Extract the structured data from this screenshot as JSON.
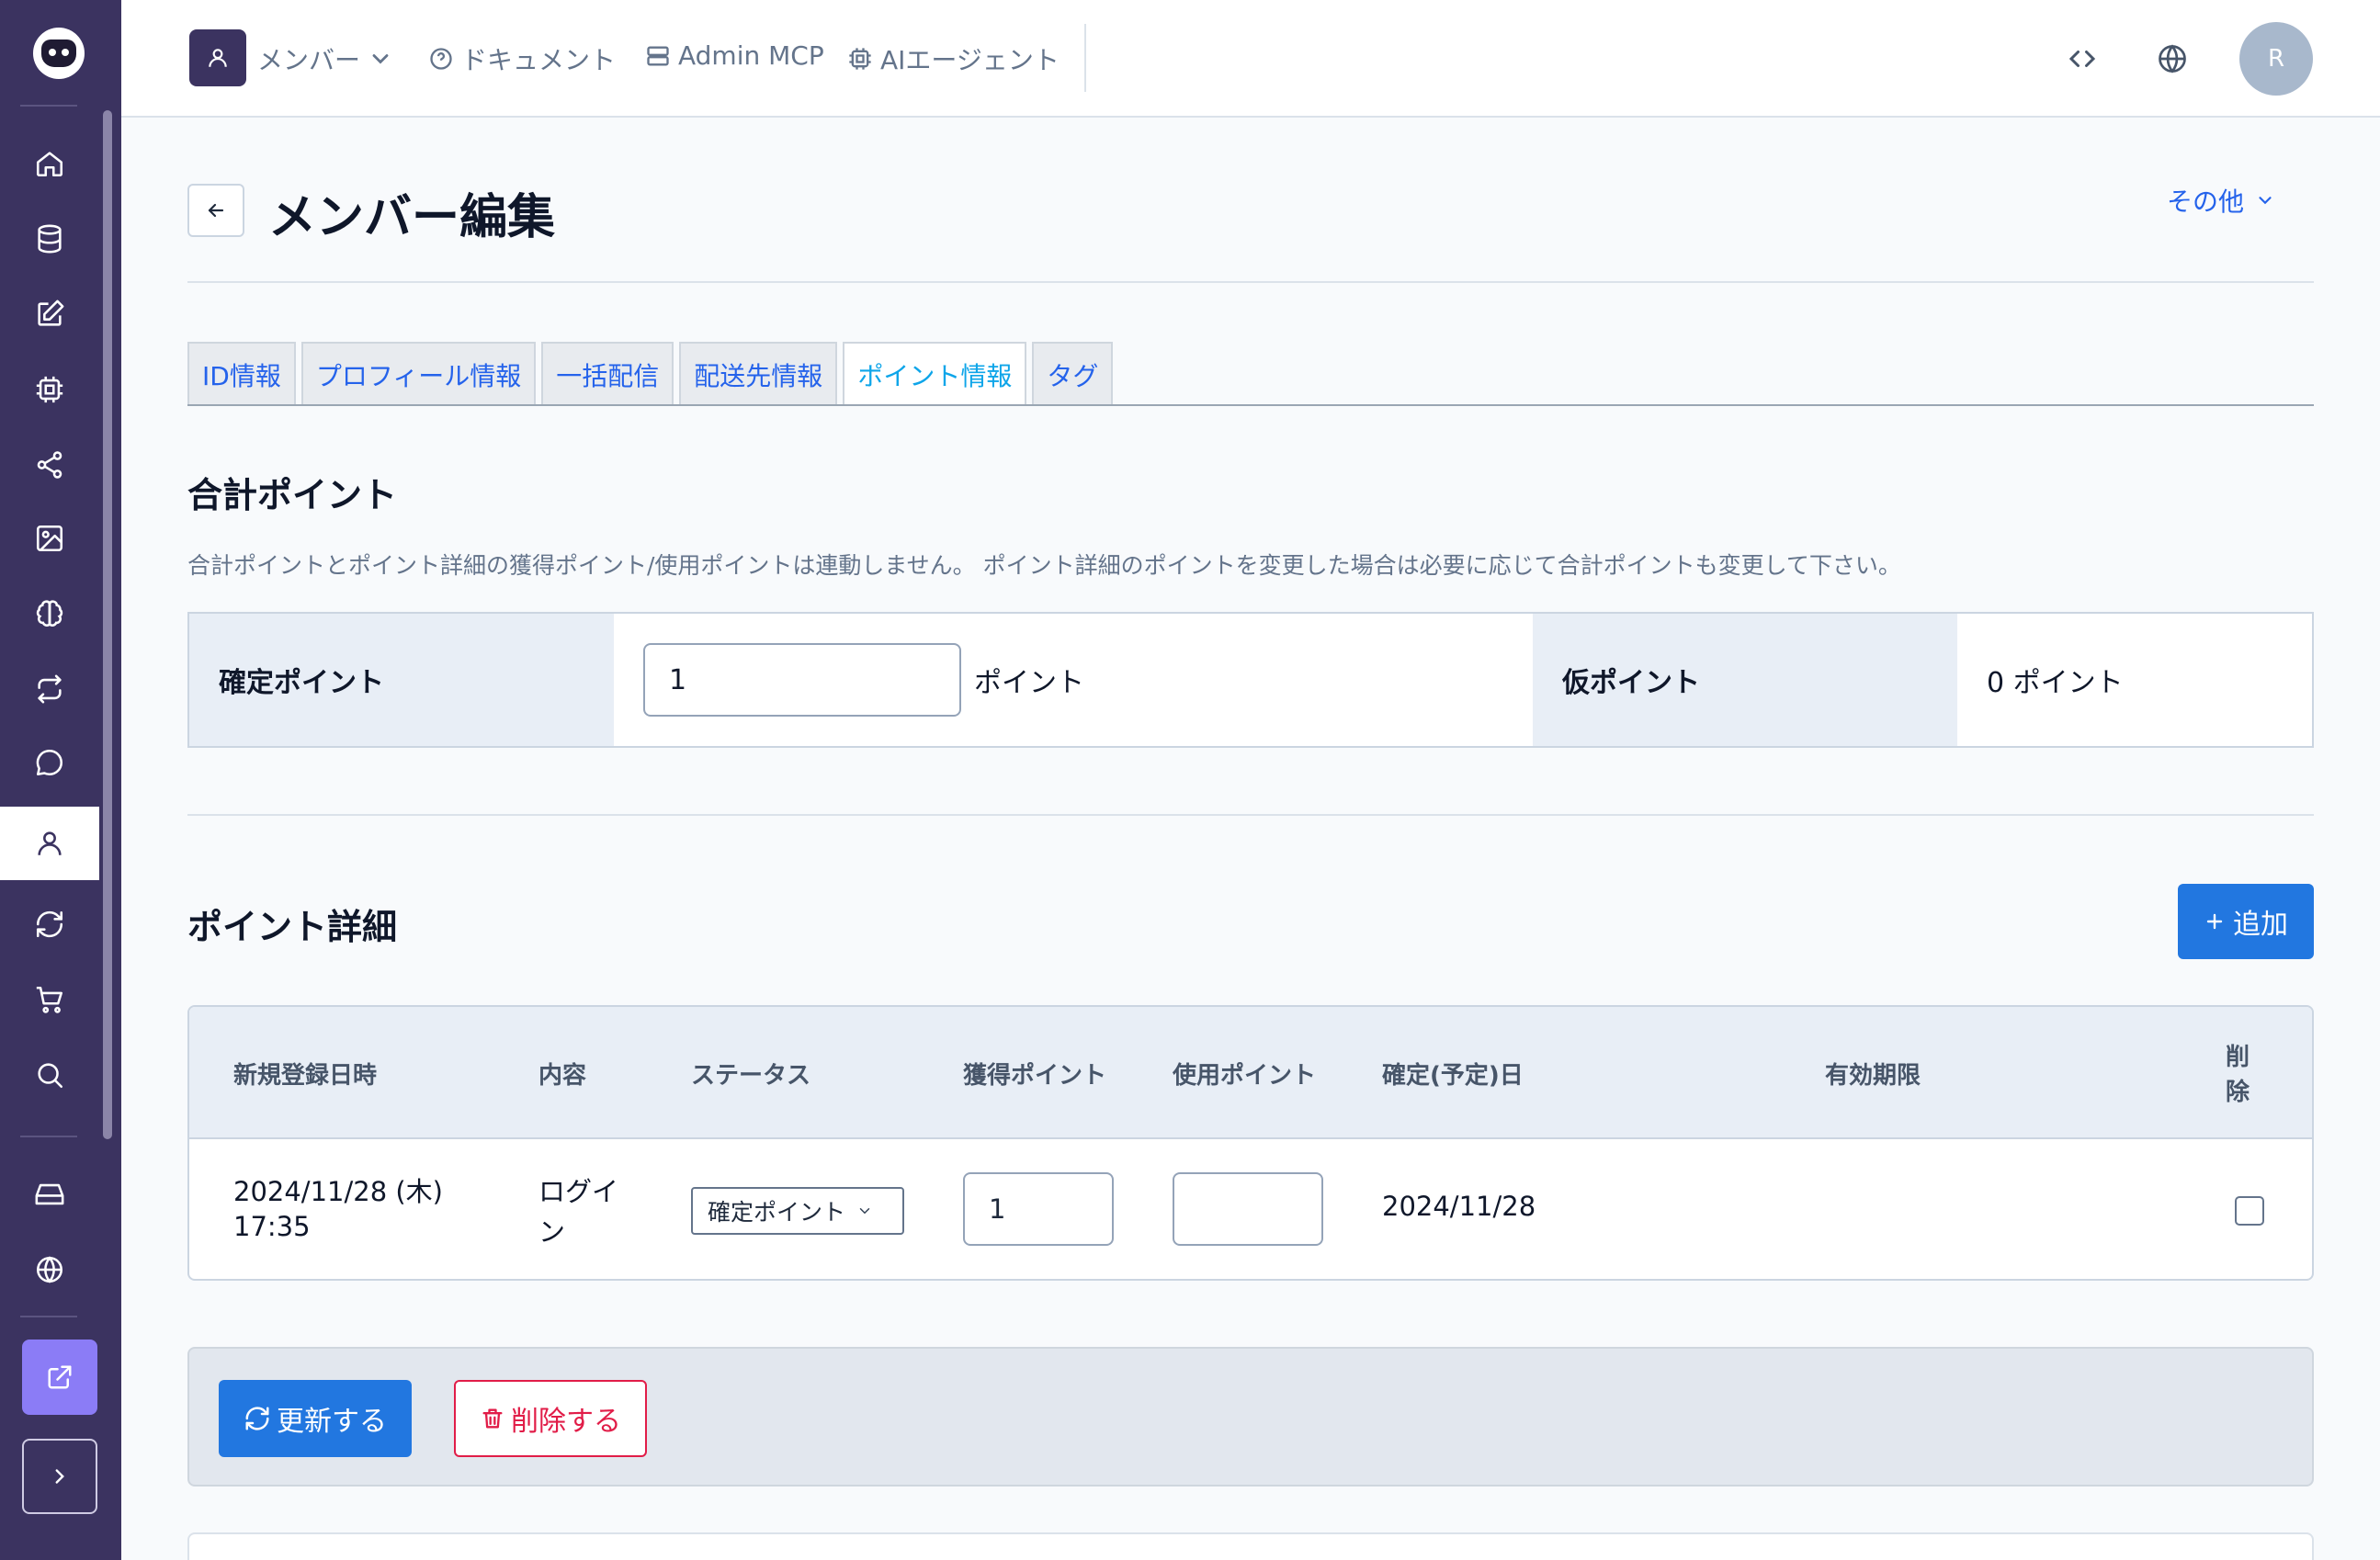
{
  "topbar": {
    "member_menu": "メンバー",
    "docs_link": "ドキュメント",
    "admin_mcp_link": "Admin MCP",
    "ai_agent_link": "AIエージェント",
    "avatar_initial": "R"
  },
  "page": {
    "title": "メンバー編集",
    "other_menu": "その他"
  },
  "tabs": [
    {
      "label": "ID情報",
      "active": false
    },
    {
      "label": "プロフィール情報",
      "active": false
    },
    {
      "label": "一括配信",
      "active": false
    },
    {
      "label": "配送先情報",
      "active": false
    },
    {
      "label": "ポイント情報",
      "active": true
    },
    {
      "label": "タグ",
      "active": false
    }
  ],
  "total_points": {
    "title": "合計ポイント",
    "note": "合計ポイントとポイント詳細の獲得ポイント/使用ポイントは連動しません。 ポイント詳細のポイントを変更した場合は必要に応じて合計ポイントも変更して下さい。",
    "confirmed_label": "確定ポイント",
    "confirmed_value": "1",
    "unit": "ポイント",
    "provisional_label": "仮ポイント",
    "provisional_value": "0 ポイント"
  },
  "point_details": {
    "title": "ポイント詳細",
    "add_button": "追加",
    "headers": {
      "created": "新規登録日時",
      "content": "内容",
      "status": "ステータス",
      "earned": "獲得ポイント",
      "used": "使用ポイント",
      "confirm_date": "確定(予定)日",
      "expiry": "有効期限",
      "delete_1": "削",
      "delete_2": "除"
    },
    "rows": [
      {
        "created_date": "2024/11/28 (木)",
        "created_time": "17:35",
        "content_1": "ログイ",
        "content_2": "ン",
        "status": "確定ポイント",
        "earned": "1",
        "used": "",
        "confirm_date": "2024/11/28",
        "expiry": "",
        "delete_checked": false
      }
    ]
  },
  "actions": {
    "update": "更新する",
    "delete": "削除する"
  },
  "colors": {
    "sidebar": "#3b3360",
    "primary": "#2277e0",
    "danger": "#e11d48",
    "accent_purple": "#8b7cf6"
  }
}
